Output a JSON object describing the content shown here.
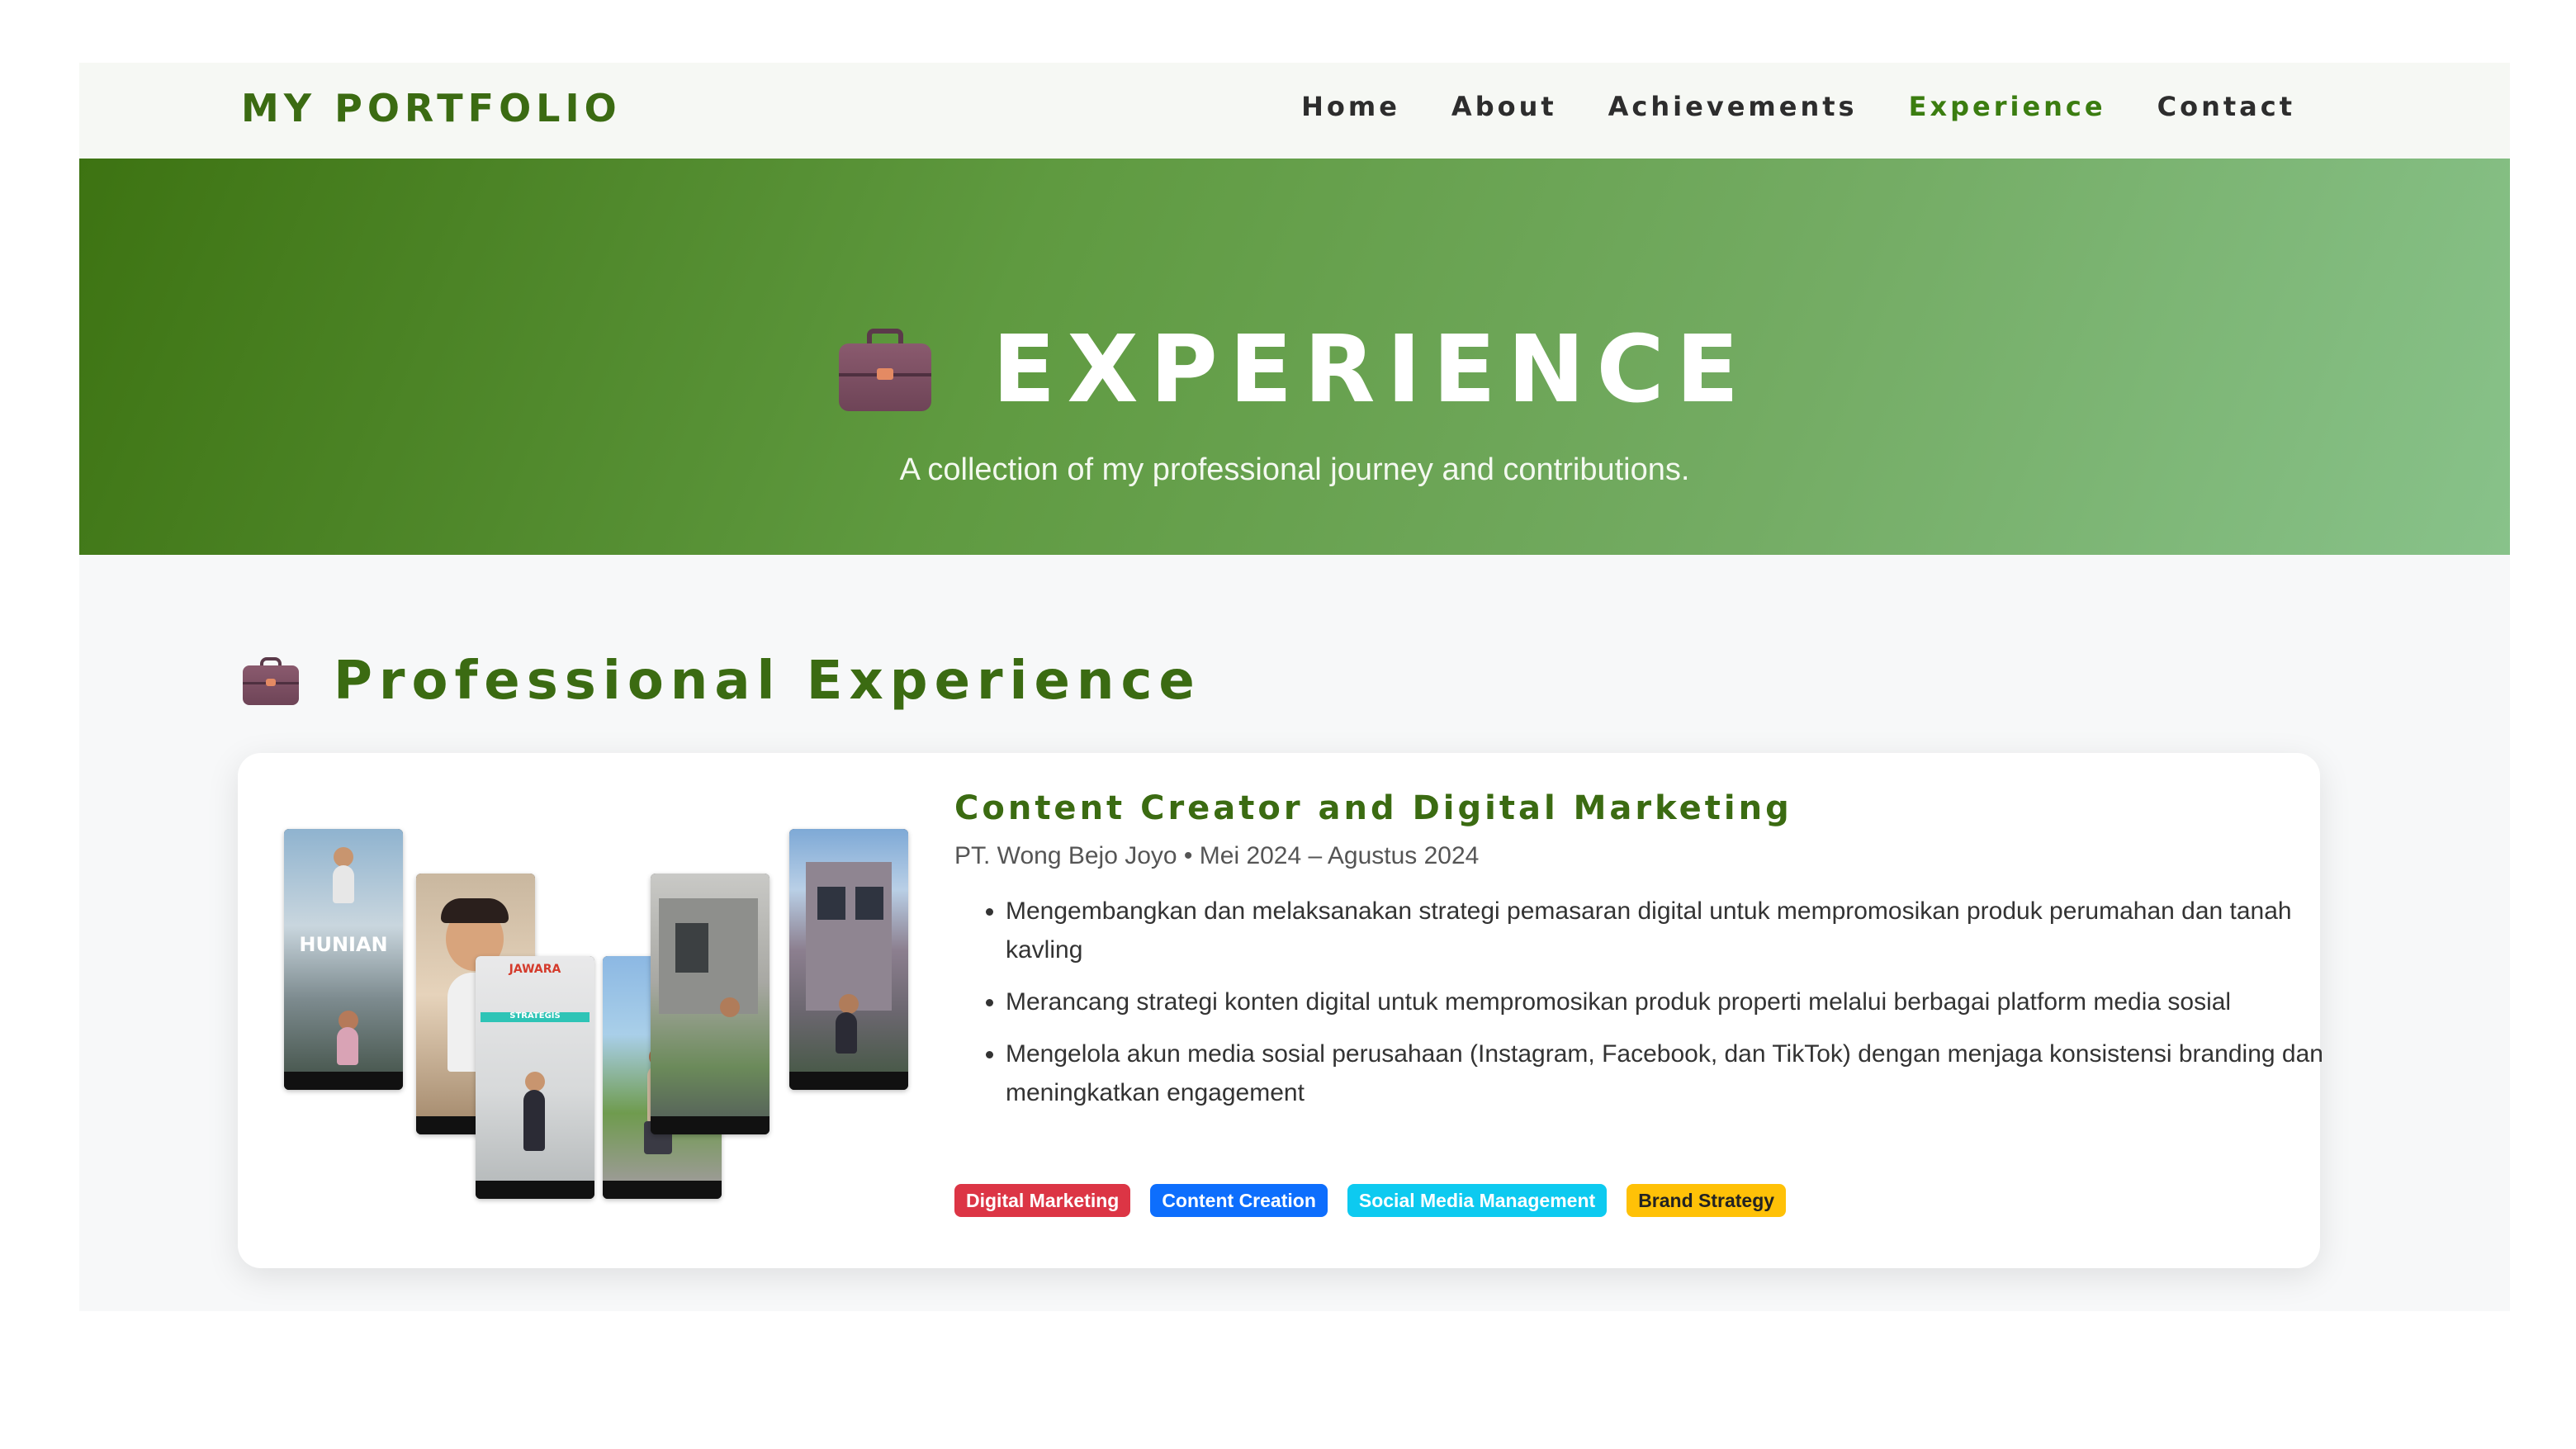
{
  "navbar": {
    "brand": "MY PORTFOLIO",
    "links": [
      {
        "label": "Home",
        "active": false
      },
      {
        "label": "About",
        "active": false
      },
      {
        "label": "Achievements",
        "active": false
      },
      {
        "label": "Experience",
        "active": true
      },
      {
        "label": "Contact",
        "active": false
      }
    ]
  },
  "hero": {
    "icon": "briefcase-icon",
    "title": "EXPERIENCE",
    "subtitle": "A collection of my professional journey and contributions."
  },
  "section": {
    "icon": "briefcase-icon",
    "title": "Professional Experience"
  },
  "experience": {
    "image_alt": "content collage",
    "collage_texts": {
      "hunian": "HUNIAN",
      "jawara": "JAWARA",
      "strategis": "STRATEGIS"
    },
    "title": "Content Creator and Digital Marketing",
    "meta": "PT. Wong Bejo Joyo • Mei 2024 – Agustus 2024",
    "bullets": [
      "Mengembangkan dan melaksanakan strategi pemasaran digital untuk mempromosikan produk perumahan dan tanah kavling",
      "Merancang strategi konten digital untuk mempromosikan produk properti melalui berbagai platform media sosial",
      "Mengelola akun media sosial perusahaan (Instagram, Facebook, dan TikTok) dengan menjaga konsistensi branding dan meningkatkan engagement"
    ],
    "tags": [
      {
        "label": "Digital Marketing",
        "bg": "#dc3545",
        "fg": "#ffffff"
      },
      {
        "label": "Content Creation",
        "bg": "#0d6efd",
        "fg": "#ffffff"
      },
      {
        "label": "Social Media Management",
        "bg": "#0dcaf0",
        "fg": "#ffffff"
      },
      {
        "label": "Brand Strategy",
        "bg": "#ffc107",
        "fg": "#222222"
      }
    ]
  },
  "colors": {
    "brand_green": "#3b6b12",
    "active_link": "#3b7d10",
    "hero_gradient_start": "#3d7312",
    "hero_gradient_end": "#88c28a"
  }
}
